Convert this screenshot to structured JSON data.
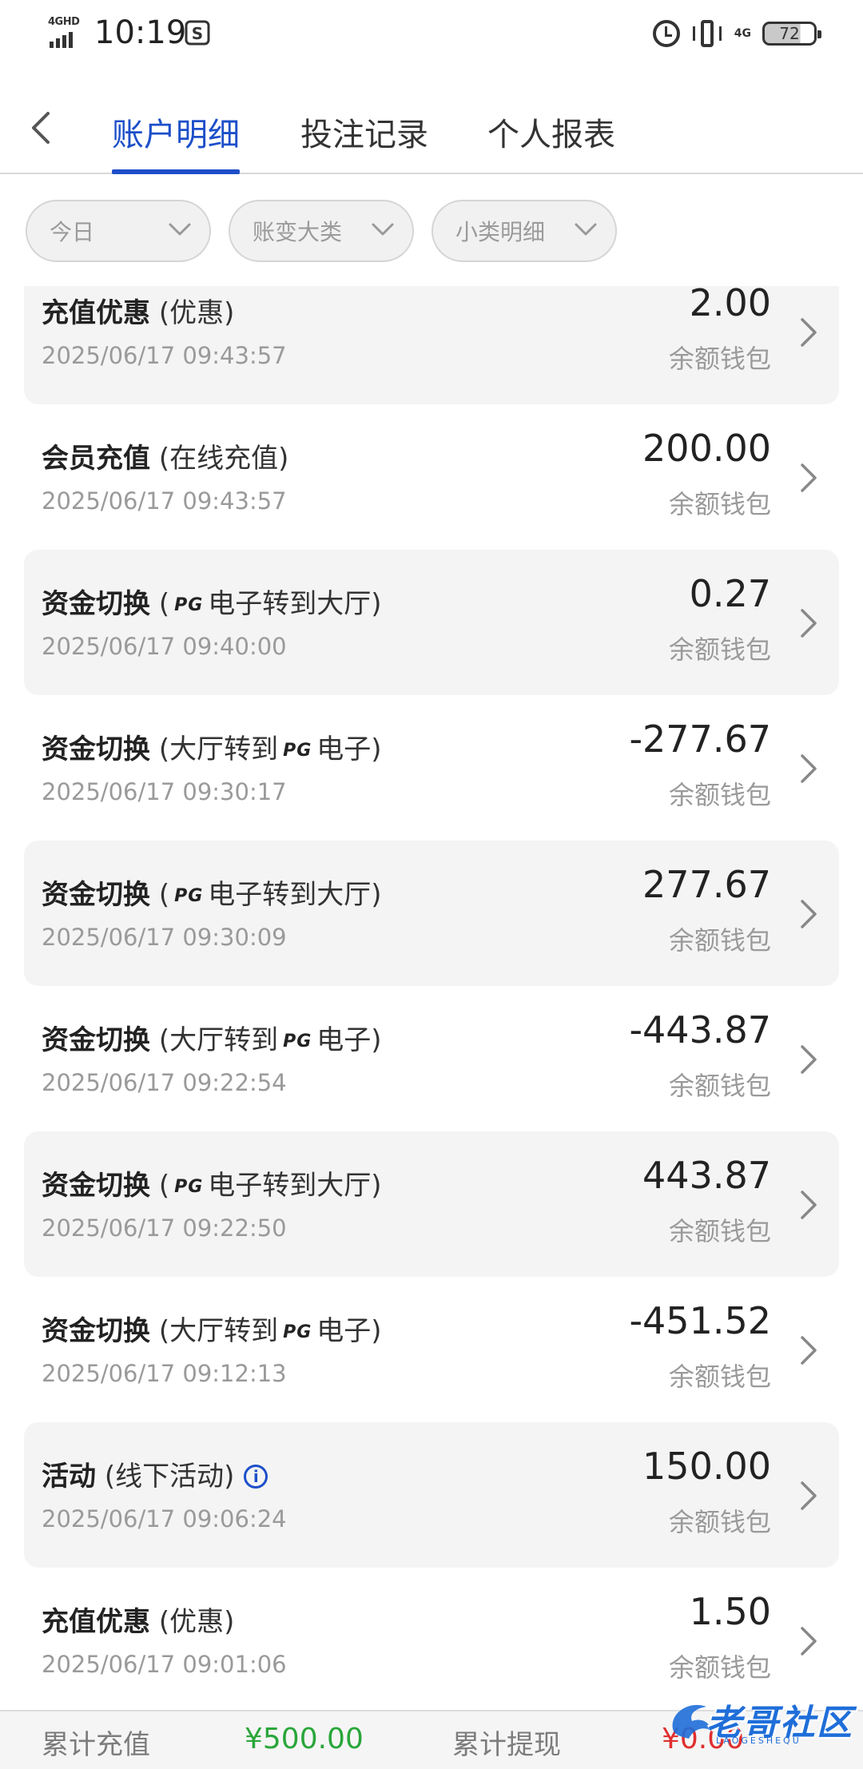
{
  "status_bar": {
    "network": "4GHD",
    "time": "10:19",
    "network_right": "4G",
    "battery": "72"
  },
  "nav": {
    "back_icon": "chevron-left-icon",
    "tabs": [
      {
        "label": "账户明细",
        "active": true
      },
      {
        "label": "投注记录",
        "active": false
      },
      {
        "label": "个人报表",
        "active": false
      }
    ],
    "accent_color": "#1d4fc9"
  },
  "filters": [
    {
      "label": "今日"
    },
    {
      "label": "账变大类"
    },
    {
      "label": "小类明细"
    }
  ],
  "transactions": [
    {
      "title": "充值优惠",
      "sub_pre": "(优惠)",
      "brand": "",
      "sub_post": "",
      "time": "2025/06/17 09:43:57",
      "amount": "2.00",
      "wallet": "余额钱包"
    },
    {
      "title": "会员充值",
      "sub_pre": "(在线充值)",
      "brand": "",
      "sub_post": "",
      "time": "2025/06/17 09:43:57",
      "amount": "200.00",
      "wallet": "余额钱包"
    },
    {
      "title": "资金切换",
      "sub_pre": "(",
      "brand": "PG",
      "sub_post": "电子转到大厅)",
      "time": "2025/06/17 09:40:00",
      "amount": "0.27",
      "wallet": "余额钱包"
    },
    {
      "title": "资金切换",
      "sub_pre": "(大厅转到",
      "brand": "PG",
      "sub_post": "电子)",
      "time": "2025/06/17 09:30:17",
      "amount": "-277.67",
      "wallet": "余额钱包"
    },
    {
      "title": "资金切换",
      "sub_pre": "(",
      "brand": "PG",
      "sub_post": "电子转到大厅)",
      "time": "2025/06/17 09:30:09",
      "amount": "277.67",
      "wallet": "余额钱包"
    },
    {
      "title": "资金切换",
      "sub_pre": "(大厅转到",
      "brand": "PG",
      "sub_post": "电子)",
      "time": "2025/06/17 09:22:54",
      "amount": "-443.87",
      "wallet": "余额钱包"
    },
    {
      "title": "资金切换",
      "sub_pre": "(",
      "brand": "PG",
      "sub_post": "电子转到大厅)",
      "time": "2025/06/17 09:22:50",
      "amount": "443.87",
      "wallet": "余额钱包"
    },
    {
      "title": "资金切换",
      "sub_pre": "(大厅转到",
      "brand": "PG",
      "sub_post": "电子)",
      "time": "2025/06/17 09:12:13",
      "amount": "-451.52",
      "wallet": "余额钱包"
    },
    {
      "title": "活动",
      "sub_pre": "(线下活动)",
      "brand": "",
      "sub_post": "",
      "info_icon": true,
      "time": "2025/06/17 09:06:24",
      "amount": "150.00",
      "wallet": "余额钱包"
    },
    {
      "title": "充值优惠",
      "sub_pre": "(优惠)",
      "brand": "",
      "sub_post": "",
      "time": "2025/06/17 09:01:06",
      "amount": "1.50",
      "wallet": "余额钱包"
    }
  ],
  "summary": {
    "deposit_label": "累计充值",
    "deposit_value": "¥500.00",
    "deposit_color": "#2aa63a",
    "withdraw_label": "累计提现",
    "withdraw_value": "¥0.00",
    "withdraw_color": "#e02f2f"
  },
  "watermark": {
    "text": "老哥社区",
    "sub": "LAOGESHEQU"
  }
}
